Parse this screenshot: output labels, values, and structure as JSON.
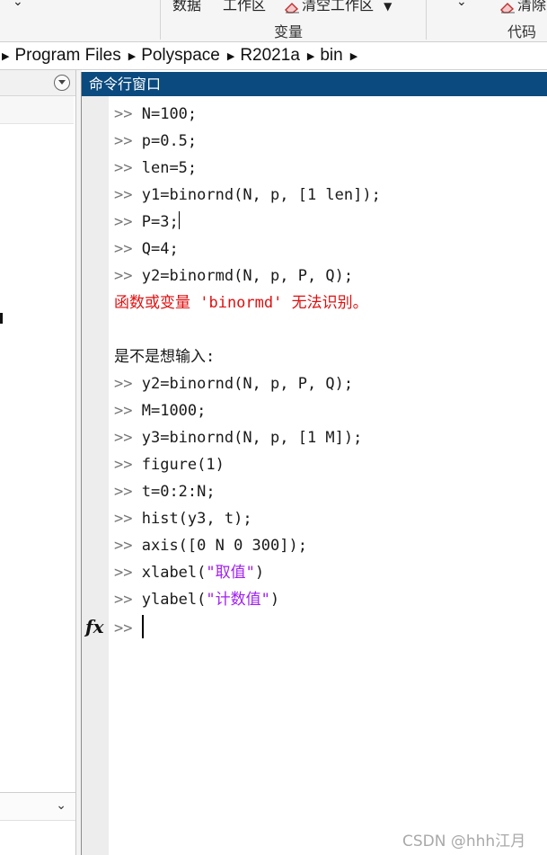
{
  "toolstrip": {
    "items": [
      {
        "label": "数据"
      },
      {
        "label": "工作区"
      },
      {
        "label": "清空工作区"
      },
      {
        "label": "清除"
      }
    ],
    "groups": [
      {
        "label": "变量"
      },
      {
        "label": "代码"
      }
    ]
  },
  "breadcrumb": {
    "segments": [
      "Program Files",
      "Polyspace",
      "R2021a",
      "bin"
    ]
  },
  "command_window": {
    "title": "命令行窗口",
    "prompt": ">>",
    "lines": [
      {
        "type": "cmd",
        "text": "N=100;"
      },
      {
        "type": "cmd",
        "text": "p=0.5;"
      },
      {
        "type": "cmd",
        "text": "len=5;"
      },
      {
        "type": "cmd",
        "text": "y1=binornd(N, p, [1 len]);"
      },
      {
        "type": "cmd",
        "text": "P=3;"
      },
      {
        "type": "cmd",
        "text": "Q=4;"
      },
      {
        "type": "cmd",
        "text": "y2=binormd(N, p, P, Q);"
      },
      {
        "type": "error",
        "text": "函数或变量 'binormd' 无法识别。"
      },
      {
        "type": "blank",
        "text": ""
      },
      {
        "type": "info",
        "text": "是不是想输入:"
      },
      {
        "type": "cmd",
        "text": "y2=binornd(N, p, P, Q);"
      },
      {
        "type": "cmd",
        "text": "M=1000;"
      },
      {
        "type": "cmd",
        "text": "y3=binornd(N, p, [1 M]);"
      },
      {
        "type": "cmd",
        "text": "figure(1)"
      },
      {
        "type": "cmd",
        "text": "t=0:2:N;"
      },
      {
        "type": "cmd",
        "text": "hist(y3, t);"
      },
      {
        "type": "cmd",
        "text": "axis([0 N 0 300]);"
      },
      {
        "type": "cmd",
        "text": "xlabel(\"取值\")"
      },
      {
        "type": "cmd",
        "text": "ylabel(\"计数值\")"
      }
    ],
    "fx_label": "fx",
    "colors": {
      "title_bar": "#0b4a7e",
      "error": "#e01010",
      "string": "#a020f0"
    }
  },
  "watermark": "CSDN @hhh江月"
}
